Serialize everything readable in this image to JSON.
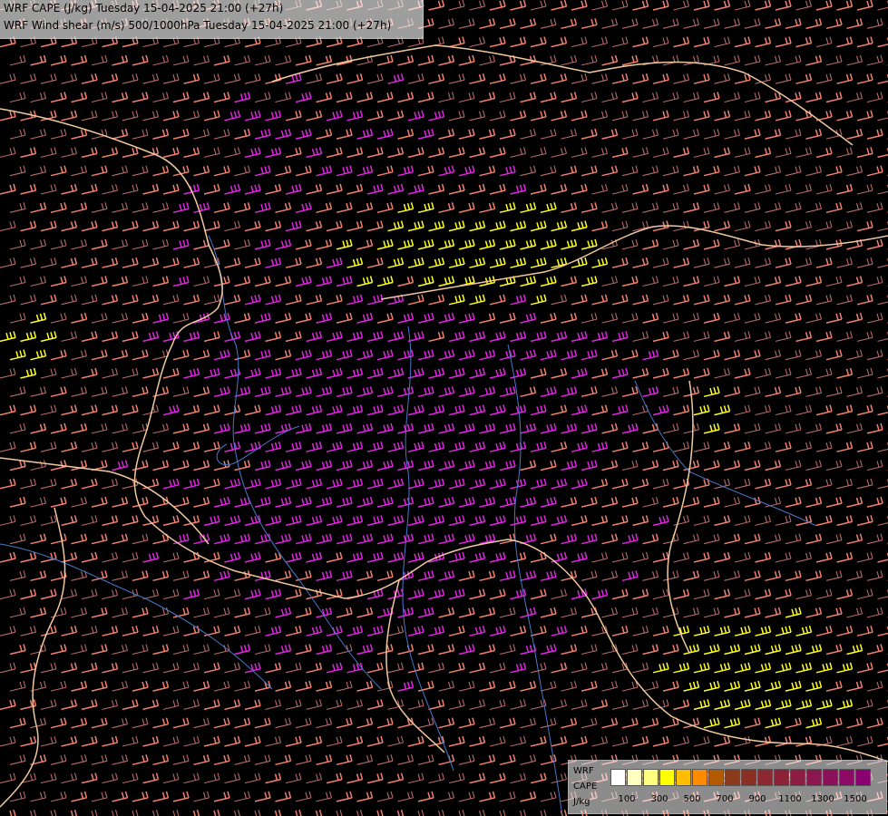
{
  "title": {
    "line1": "WRF CAPE (J/kg) Tuesday 15-04-2025 21:00 (+27h)",
    "line2": "WRF Wind shear (m/s) 500/1000hPa Tuesday 15-04-2025 21:00 (+27h)"
  },
  "legend": {
    "label_top": "WRF",
    "label_mid": "CAPE",
    "label_bottom": "J/kg",
    "tick_labels": [
      "100",
      "300",
      "500",
      "700",
      "900",
      "1100",
      "1300",
      "1500"
    ],
    "colors": [
      "#ffffff",
      "#ffffbf",
      "#ffff80",
      "#ffff00",
      "#ffbf00",
      "#ff8c00",
      "#b35900",
      "#8c3a1e",
      "#8a2f24",
      "#8c2830",
      "#8c2238",
      "#8c1c42",
      "#8c164e",
      "#8c105a",
      "#8c0a66",
      "#8c0072"
    ]
  },
  "barb_colors": {
    "weak": "#b86b6b",
    "moderate": "#f08070",
    "strong": "#e025e0",
    "very_strong": "#ffff20"
  },
  "border_color": "#f0c8a0",
  "river_color": "#4a78c8"
}
